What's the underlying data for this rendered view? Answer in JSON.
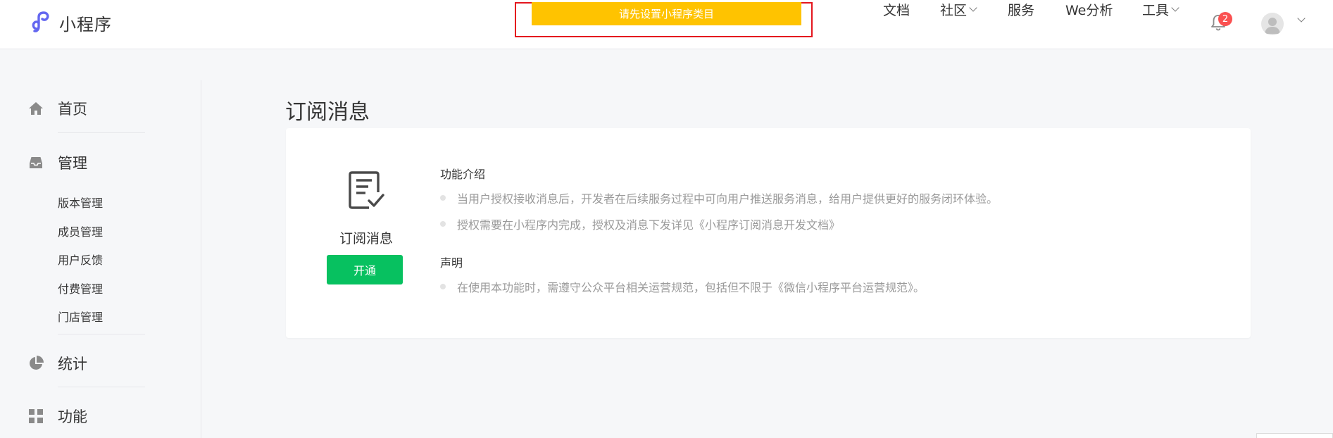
{
  "app": {
    "name": "小程序"
  },
  "notice": {
    "text": "请先设置小程序类目"
  },
  "nav": {
    "docs": "文档",
    "community": "社区",
    "services": "服务",
    "analytics": "We分析",
    "tools": "工具",
    "notification_count": "2"
  },
  "sidebar": {
    "home": "首页",
    "manage": "管理",
    "manage_items": [
      "版本管理",
      "成员管理",
      "用户反馈",
      "付费管理",
      "门店管理"
    ],
    "stats": "统计",
    "features": "功能"
  },
  "page": {
    "title": "订阅消息",
    "card": {
      "name": "订阅消息",
      "open_button": "开通",
      "intro_title": "功能介绍",
      "intro_items": [
        "当用户授权接收消息后，开发者在后续服务过程中可向用户推送服务消息，给用户提供更好的服务闭环体验。",
        "授权需要在小程序内完成，授权及消息下发详见《小程序订阅消息开发文档》"
      ],
      "statement_title": "声明",
      "statement_items": [
        "在使用本功能时，需遵守公众平台相关运营规范，包括但不限于《微信小程序平台运营规范》。"
      ]
    }
  },
  "colors": {
    "brand_purple": "#6467f0",
    "notice_yellow": "#ffc300",
    "highlight_red": "#e4161e",
    "primary_green": "#07c160",
    "badge_red": "#fa5151"
  }
}
